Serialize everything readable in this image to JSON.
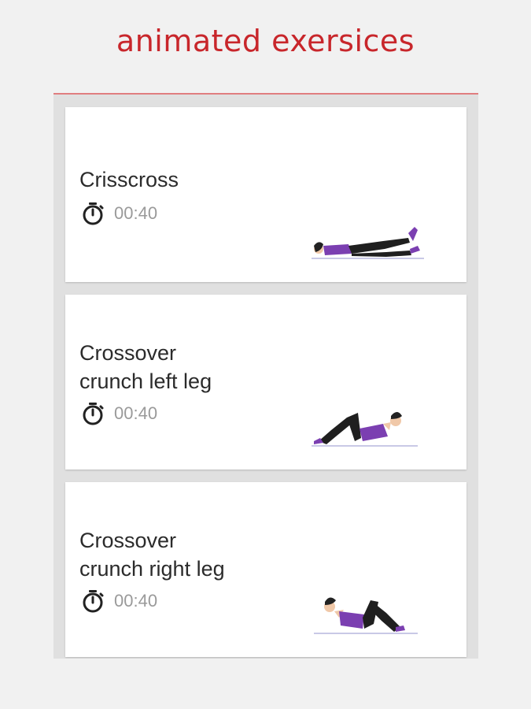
{
  "header": {
    "title": "animated exersices"
  },
  "exercises": [
    {
      "name": "Crisscross",
      "duration": "00:40",
      "icon": "stopwatch-icon",
      "illustration": "lying-legs-raised-figure"
    },
    {
      "name": "Crossover\ncrunch left leg",
      "duration": "00:40",
      "icon": "stopwatch-icon",
      "illustration": "crunch-left-figure"
    },
    {
      "name": "Crossover\ncrunch right leg",
      "duration": "00:40",
      "icon": "stopwatch-icon",
      "illustration": "crunch-right-figure"
    }
  ],
  "colors": {
    "accent": "#c8262b",
    "panel_background": "#e0e0e0",
    "card_background": "#ffffff",
    "figure_top": "#7b3fb1",
    "figure_legs": "#1f1f1f"
  }
}
